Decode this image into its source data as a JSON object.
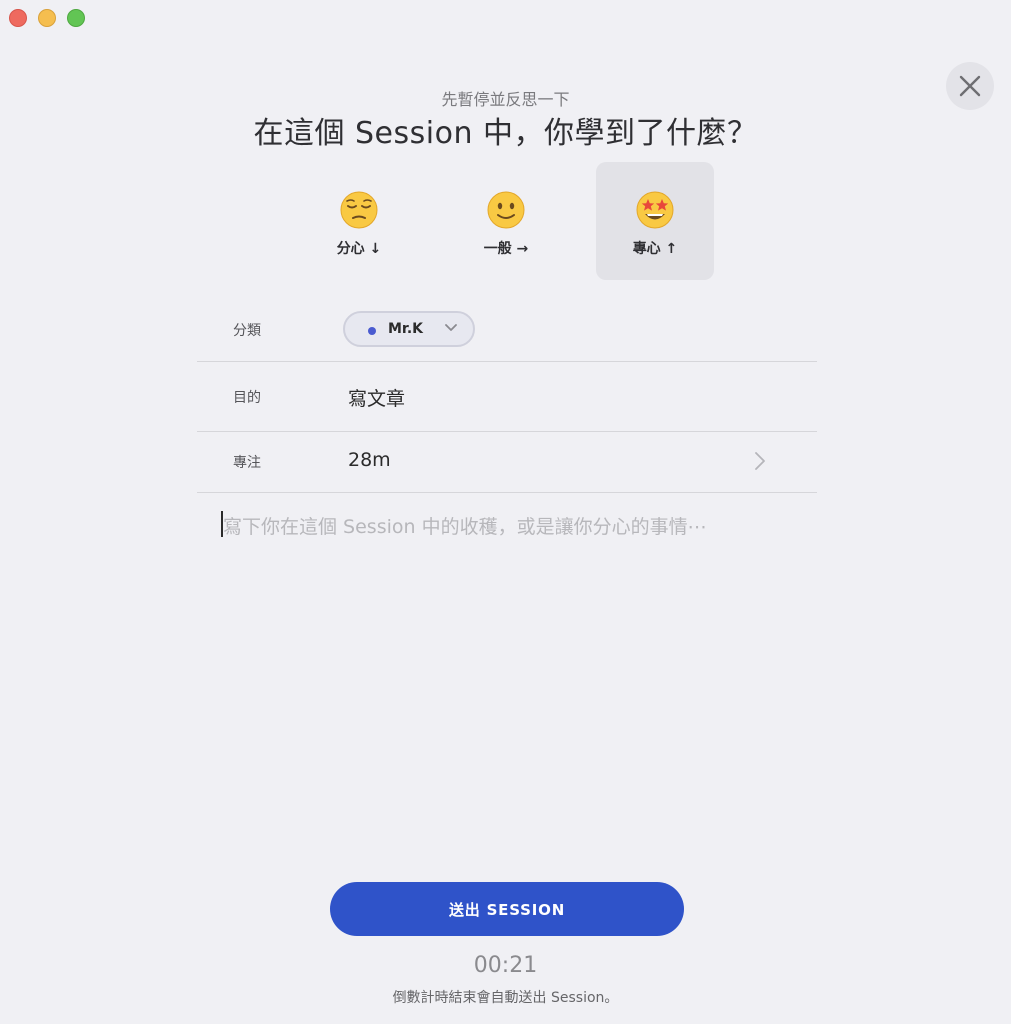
{
  "header": {
    "subtitle": "先暫停並反思一下",
    "title": "在這個 Session 中，你學到了什麼？"
  },
  "moods": [
    {
      "label": "分心 ↓",
      "icon": "pensive-face-icon",
      "selected": false
    },
    {
      "label": "一般 →",
      "icon": "slightly-smiling-face-icon",
      "selected": false
    },
    {
      "label": "專心 ↑",
      "icon": "star-struck-face-icon",
      "selected": true
    }
  ],
  "fields": {
    "category": {
      "label": "分類",
      "value": "Mr.K",
      "dot_color": "#4a5bd0"
    },
    "purpose": {
      "label": "目的",
      "value": "寫文章"
    },
    "focus": {
      "label": "專注",
      "value": "28m"
    }
  },
  "note": {
    "placeholder": "寫下你在這個 Session 中的收穫，或是讓你分心的事情⋯"
  },
  "submit": {
    "label": "送出 SESSION"
  },
  "countdown": {
    "time": "00:21",
    "note": "倒數計時結束會自動送出 Session。"
  },
  "colors": {
    "accent": "#2f53c9",
    "background": "#f0f0f4",
    "selected_mood_bg": "#e2e2e7"
  }
}
